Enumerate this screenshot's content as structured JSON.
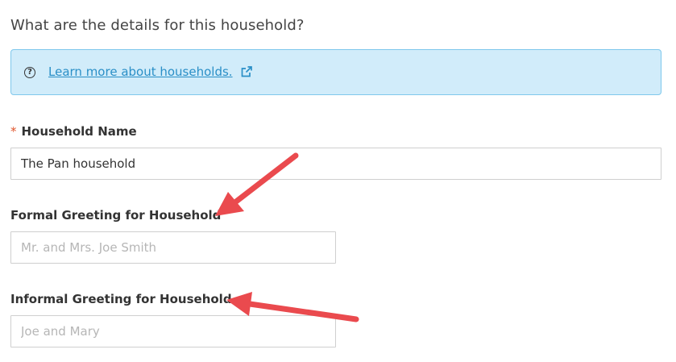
{
  "heading": "What are the details for this household?",
  "info": {
    "link_text": "Learn more about households.",
    "help_icon_glyph": "?",
    "link_icon": "external-link-icon"
  },
  "fields": {
    "household_name": {
      "required_mark": "*",
      "label": "Household Name",
      "value": "The Pan household"
    },
    "formal_greeting": {
      "label": "Formal Greeting for Household",
      "value": "",
      "placeholder": "Mr. and Mrs. Joe Smith"
    },
    "informal_greeting": {
      "label": "Informal Greeting for Household",
      "value": "",
      "placeholder": "Joe and Mary"
    }
  },
  "colors": {
    "info_bg": "#d1ecfa",
    "info_border": "#7fc8ec",
    "link": "#2a8fc7",
    "required": "#e0552c",
    "annotation_arrow": "#ea4a4e"
  }
}
